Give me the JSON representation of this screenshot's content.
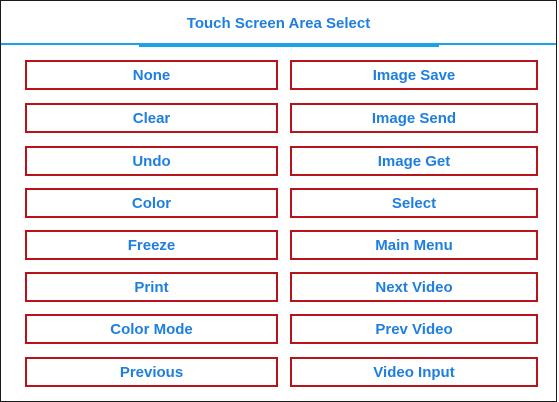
{
  "header": {
    "title": "Touch Screen Area Select"
  },
  "buttons": {
    "left": [
      "None",
      "Clear",
      "Undo",
      "Color",
      "Freeze",
      "Print",
      "Color Mode",
      "Previous"
    ],
    "right": [
      "Image Save",
      "Image Send",
      "Image Get",
      "Select",
      "Main Menu",
      "Next Video",
      "Prev Video",
      "Video Input"
    ]
  },
  "colors": {
    "text": "#1e7fe0",
    "button_border": "#b8121b",
    "header_rule": "#1aa3e8"
  }
}
